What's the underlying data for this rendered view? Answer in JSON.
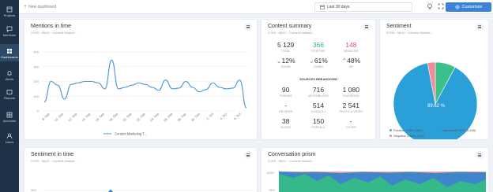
{
  "sidebar": {
    "items": [
      {
        "label": "Projects",
        "icon": "projects-icon"
      },
      {
        "label": "Mentions",
        "icon": "mentions-icon"
      },
      {
        "label": "Dashboards",
        "icon": "dashboards-icon"
      },
      {
        "label": "Alerts",
        "icon": "alerts-icon"
      },
      {
        "label": "Reports",
        "icon": "reports-icon"
      },
      {
        "label": "Accounts",
        "icon": "accounts-icon"
      },
      {
        "label": "Users",
        "icon": "users-icon"
      }
    ]
  },
  "topbar": {
    "new_dashboard": "New dashboard",
    "date_range": "Last 30 days",
    "customize": "Customize"
  },
  "mentions": {
    "title": "Mentions in time",
    "subtitle": "07/09 - 06/10 · Content Marketi...",
    "legend": "Content Marketing T..."
  },
  "content_summary": {
    "title": "Content summary",
    "subtitle": "07/09 - 06/10 · Content Marketi...",
    "row1": [
      {
        "value": "5 129",
        "label": "TOTAL",
        "tone": "plain"
      },
      {
        "value": "366",
        "label": "POSITIVE",
        "tone": "green"
      },
      {
        "value": "148",
        "label": "NEGATIVE",
        "tone": "red"
      }
    ],
    "row2": [
      {
        "value": "12%",
        "label": "DOWN",
        "tone": "down"
      },
      {
        "value": "61%",
        "label": "DOWN",
        "tone": "down"
      },
      {
        "value": "48%",
        "label": "UP",
        "tone": "up"
      }
    ],
    "sources_title": "SOURCES BREAKDOWN",
    "row3": [
      {
        "value": "90",
        "label": "FORUMS"
      },
      {
        "value": "716",
        "label": "MICROBLOGS"
      },
      {
        "value": "1 080",
        "label": "FACEBOOK"
      }
    ],
    "row4": [
      {
        "value": "-",
        "label": "REVIEWS"
      },
      {
        "value": "514",
        "label": "GOOGLE+"
      },
      {
        "value": "2 541",
        "label": "PHOTO & VIDEO"
      }
    ],
    "row5": [
      {
        "value": "38",
        "label": "BLOGS"
      },
      {
        "value": "150",
        "label": "PORTALS"
      },
      {
        "value": "-",
        "label": "OTHER"
      }
    ]
  },
  "sentiment": {
    "title": "Sentiment",
    "subtitle": "07/09 - 06/10 · Content Marketi...",
    "center_label": "89.62 %",
    "legend_positive": "Positive 7.38% (366)",
    "legend_neutral": "Neutral 89.62% (4 639)",
    "legend_negative": "Negative 2.88% (148)",
    "colors": {
      "positive": "#3cc08a",
      "neutral": "#2b9fd8",
      "negative": "#f08c98"
    }
  },
  "sentiment_time": {
    "title": "Sentiment in time",
    "subtitle": "07/09 - 06/10 · Content Marketi...",
    "y_top": "300"
  },
  "prism": {
    "title": "Conversation prism",
    "subtitle": "07/09 - 06/10 · Content Marketi...",
    "y_top": "100%",
    "y_next": "75%"
  },
  "chart_data": {
    "type": "line",
    "title": "Mentions in time",
    "ylim": [
      0,
      400
    ],
    "yticks": [
      "0",
      "100",
      "200",
      "300",
      "400"
    ],
    "categories": [
      "8. Sep",
      "10. Sep",
      "12. Sep",
      "14. Sep",
      "16. Sep",
      "18. Sep",
      "20. Sep",
      "22. Sep",
      "24. Sep",
      "26. Sep",
      "28. Sep",
      "30. Sep",
      "2. Oct",
      "4. Oct",
      "6. Oct"
    ],
    "series": [
      {
        "name": "Content Marketing T...",
        "values": [
          60,
          200,
          175,
          80,
          180,
          190,
          200,
          200,
          190,
          150,
          345,
          150,
          160,
          175,
          190,
          180,
          160,
          140,
          210,
          150,
          155,
          200,
          160,
          130,
          145,
          190,
          160,
          150,
          155,
          210,
          20
        ]
      }
    ]
  }
}
